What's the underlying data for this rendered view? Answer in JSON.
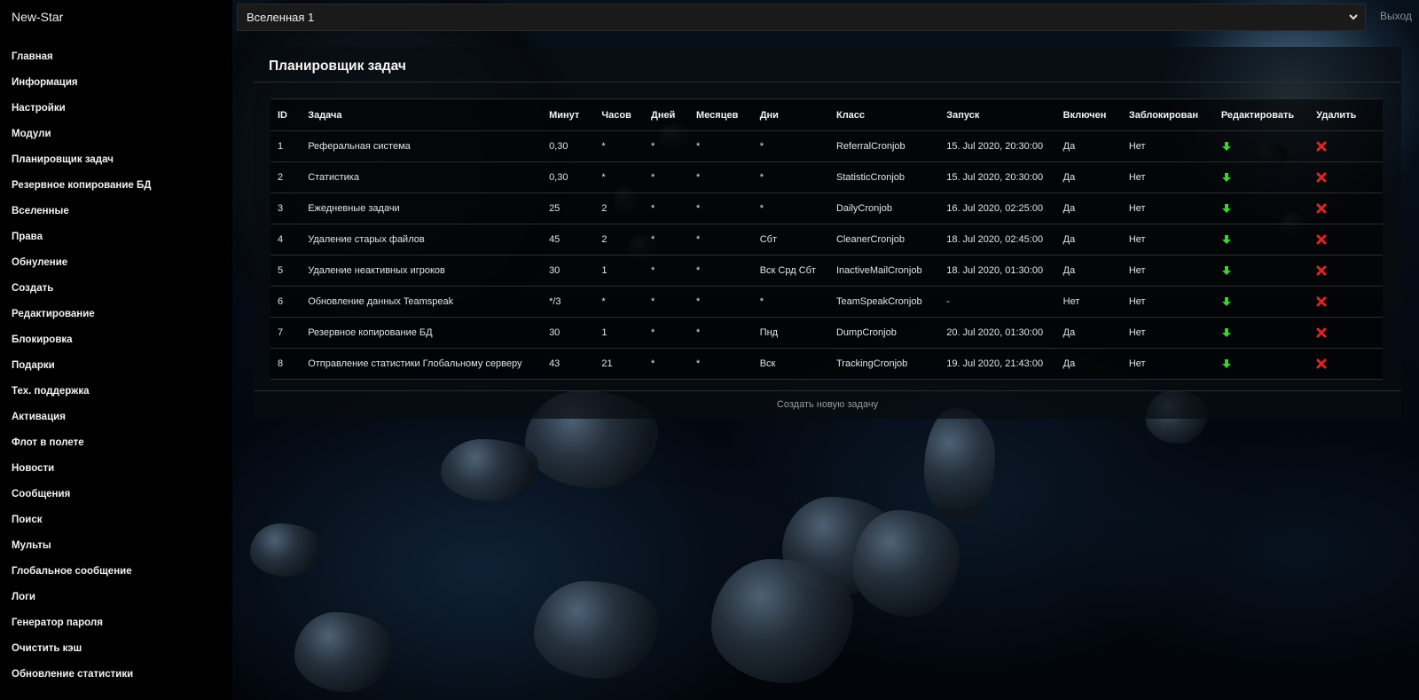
{
  "app": {
    "brand": "New-Star"
  },
  "sidebar": {
    "items": [
      {
        "label": "Главная"
      },
      {
        "label": "Информация"
      },
      {
        "label": "Настройки"
      },
      {
        "label": "Модули"
      },
      {
        "label": "Планировщик задач"
      },
      {
        "label": "Резервное копирование БД"
      },
      {
        "label": "Вселенные"
      },
      {
        "label": "Права"
      },
      {
        "label": "Обнуление"
      },
      {
        "label": "Создать"
      },
      {
        "label": "Редактирование"
      },
      {
        "label": "Блокировка"
      },
      {
        "label": "Подарки"
      },
      {
        "label": "Тех. поддержка"
      },
      {
        "label": "Активация"
      },
      {
        "label": "Флот в полете"
      },
      {
        "label": "Новости"
      },
      {
        "label": "Сообщения"
      },
      {
        "label": "Поиск"
      },
      {
        "label": "Мульты"
      },
      {
        "label": "Глобальное сообщение"
      },
      {
        "label": "Логи"
      },
      {
        "label": "Генератор пароля"
      },
      {
        "label": "Очистить кэш"
      },
      {
        "label": "Обновление статистики"
      }
    ]
  },
  "header": {
    "universe_selected": "Вселенная 1",
    "logout_label": "Выход"
  },
  "panel": {
    "title": "Планировщик задач",
    "create_label": "Создать новую задачу",
    "columns": [
      "ID",
      "Задача",
      "Минут",
      "Часов",
      "Дней",
      "Месяцев",
      "Дни",
      "Класс",
      "Запуск",
      "Включен",
      "Заблокирован",
      "Редактировать",
      "Удалить"
    ],
    "rows": [
      {
        "id": "1",
        "task": "Реферальная система",
        "min": "0,30",
        "hour": "*",
        "day": "*",
        "month": "*",
        "dow": "*",
        "cls": "ReferralCronjob",
        "run": "15. Jul 2020, 20:30:00",
        "enabled": "Да",
        "locked": "Нет"
      },
      {
        "id": "2",
        "task": "Статистика",
        "min": "0,30",
        "hour": "*",
        "day": "*",
        "month": "*",
        "dow": "*",
        "cls": "StatisticCronjob",
        "run": "15. Jul 2020, 20:30:00",
        "enabled": "Да",
        "locked": "Нет"
      },
      {
        "id": "3",
        "task": "Ежедневные задачи",
        "min": "25",
        "hour": "2",
        "day": "*",
        "month": "*",
        "dow": "*",
        "cls": "DailyCronjob",
        "run": "16. Jul 2020, 02:25:00",
        "enabled": "Да",
        "locked": "Нет"
      },
      {
        "id": "4",
        "task": "Удаление старых файлов",
        "min": "45",
        "hour": "2",
        "day": "*",
        "month": "*",
        "dow": "Сбт",
        "cls": "CleanerCronjob",
        "run": "18. Jul 2020, 02:45:00",
        "enabled": "Да",
        "locked": "Нет"
      },
      {
        "id": "5",
        "task": "Удаление неактивных игроков",
        "min": "30",
        "hour": "1",
        "day": "*",
        "month": "*",
        "dow": "Вск Срд Сбт",
        "cls": "InactiveMailCronjob",
        "run": "18. Jul 2020, 01:30:00",
        "enabled": "Да",
        "locked": "Нет"
      },
      {
        "id": "6",
        "task": "Обновление данных Teamspeak",
        "min": "*/3",
        "hour": "*",
        "day": "*",
        "month": "*",
        "dow": "*",
        "cls": "TeamSpeakCronjob",
        "run": "-",
        "enabled": "Нет",
        "locked": "Нет"
      },
      {
        "id": "7",
        "task": "Резервное копирование БД",
        "min": "30",
        "hour": "1",
        "day": "*",
        "month": "*",
        "dow": "Пнд",
        "cls": "DumpCronjob",
        "run": "20. Jul 2020, 01:30:00",
        "enabled": "Да",
        "locked": "Нет"
      },
      {
        "id": "8",
        "task": "Отправление статистики Глобальному серверу",
        "min": "43",
        "hour": "21",
        "day": "*",
        "month": "*",
        "dow": "Вск",
        "cls": "TrackingCronjob",
        "run": "19. Jul 2020, 21:43:00",
        "enabled": "Да",
        "locked": "Нет"
      }
    ]
  },
  "colors": {
    "yes": "#3bd22f",
    "no_enabled": "#e02424",
    "no_locked": "#3bd22f",
    "delete": "#e02424",
    "edit": "#3bd22f"
  },
  "icons": {
    "edit": "green-down-arrow-icon",
    "delete": "red-x-icon",
    "select": "chevron-down-icon"
  }
}
